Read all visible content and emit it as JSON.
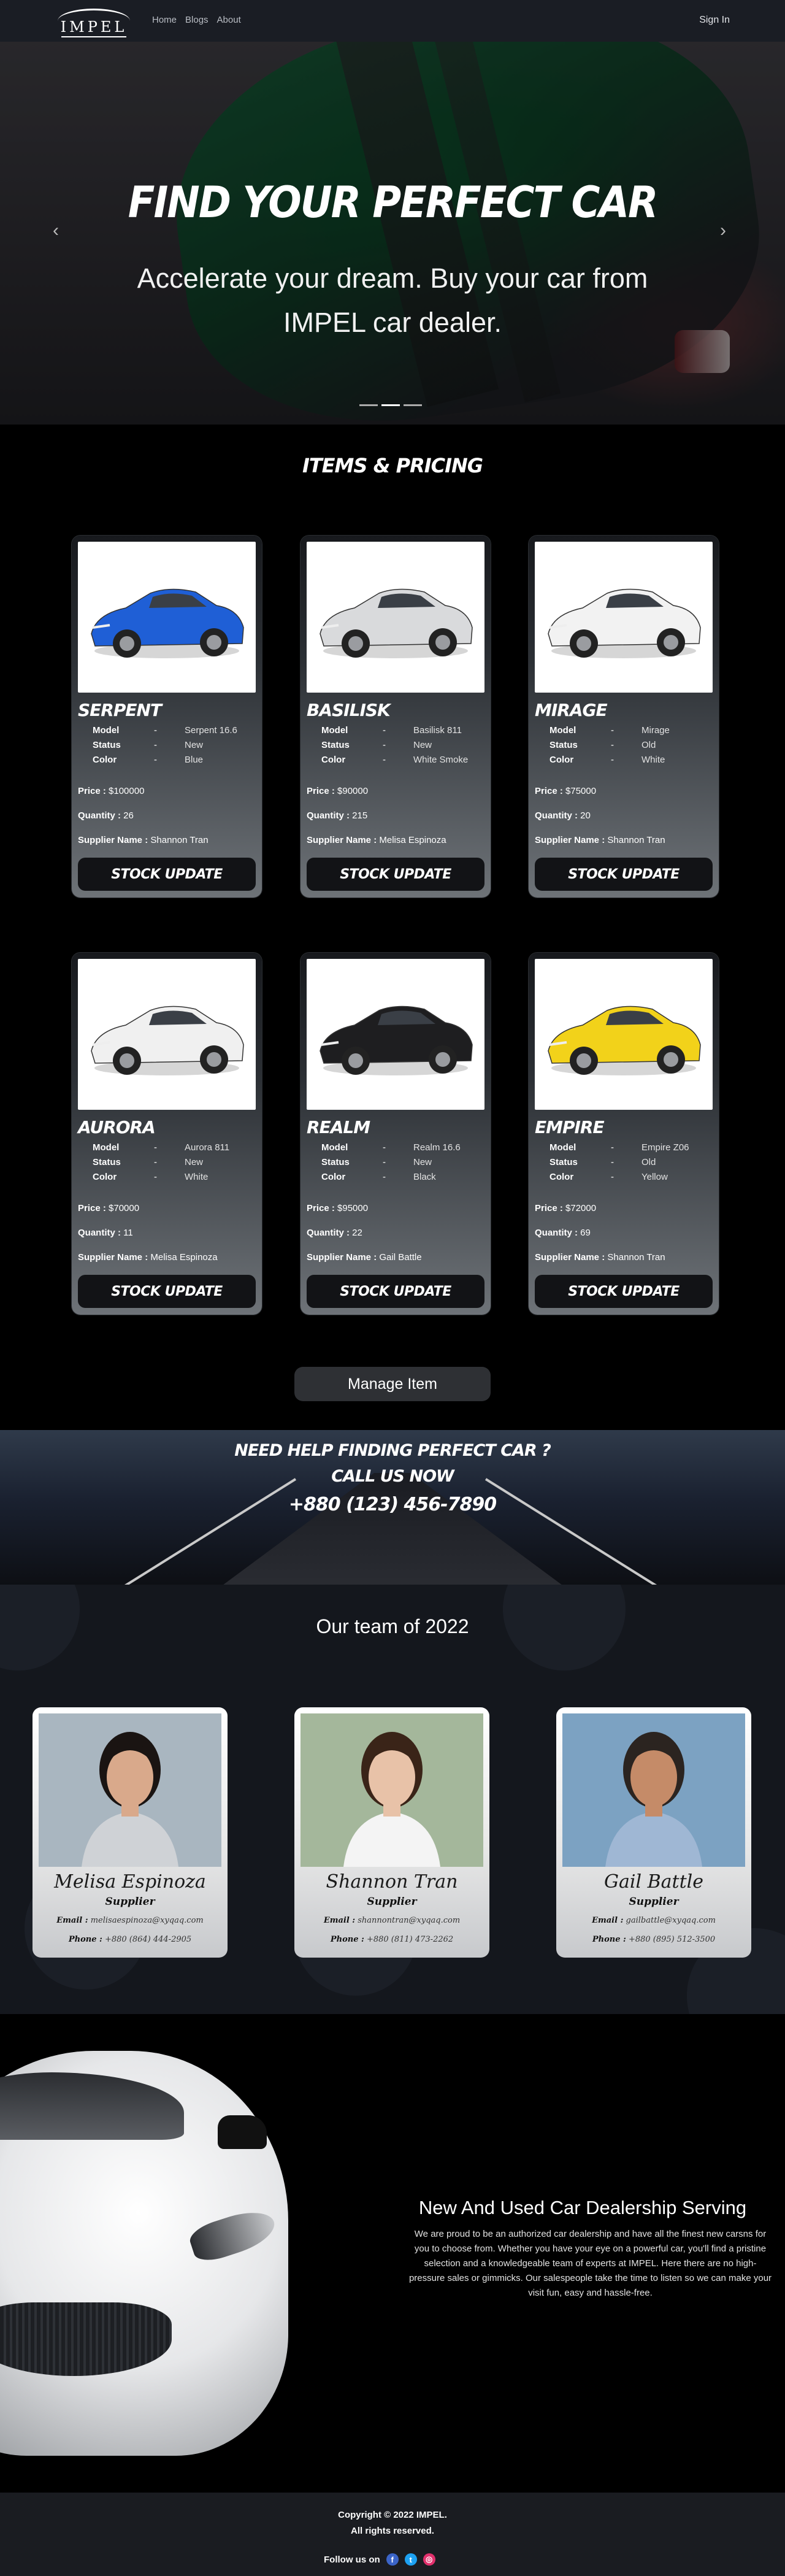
{
  "nav": {
    "logo_text": "IMPEL",
    "links": [
      "Home",
      "Blogs",
      "About"
    ],
    "signin": "Sign In"
  },
  "hero": {
    "title": "FIND YOUR PERFECT CAR",
    "subtitle": "Accelerate your dream. Buy your car from IMPEL car dealer.",
    "prev_icon": "chevron-left-icon",
    "next_icon": "chevron-right-icon",
    "slide_count": 3
  },
  "items": {
    "title": "ITEMS & PRICING",
    "labels": {
      "model": "Model",
      "status": "Status",
      "color": "Color",
      "price": "Price :",
      "quantity": "Quantity :",
      "supplier": "Supplier Name :",
      "button": "STOCK UPDATE"
    },
    "cards": [
      {
        "name": "SERPENT",
        "model": "Serpent 16.6",
        "status": "New",
        "color": "Blue",
        "price": "$100000",
        "quantity": "26",
        "supplier": "Shannon Tran",
        "car_color": "#1f5fd6"
      },
      {
        "name": "BASILISK",
        "model": "Basilisk 811",
        "status": "New",
        "color": "White Smoke",
        "price": "$90000",
        "quantity": "215",
        "supplier": "Melisa Espinoza",
        "car_color": "#d9dadc"
      },
      {
        "name": "MIRAGE",
        "model": "Mirage",
        "status": "Old",
        "color": "White",
        "price": "$75000",
        "quantity": "20",
        "supplier": "Shannon Tran",
        "car_color": "#f2f2f2"
      },
      {
        "name": "AURORA",
        "model": "Aurora 811",
        "status": "New",
        "color": "White",
        "price": "$70000",
        "quantity": "11",
        "supplier": "Melisa Espinoza",
        "car_color": "#f0f0f0"
      },
      {
        "name": "REALM",
        "model": "Realm 16.6",
        "status": "New",
        "color": "Black",
        "price": "$95000",
        "quantity": "22",
        "supplier": "Gail Battle",
        "car_color": "#1e1e20"
      },
      {
        "name": "EMPIRE",
        "model": "Empire Z06",
        "status": "Old",
        "color": "Yellow",
        "price": "$72000",
        "quantity": "69",
        "supplier": "Shannon Tran",
        "car_color": "#f2d21a"
      }
    ],
    "manage_button": "Manage Item"
  },
  "help": {
    "line1": "NEED HELP FINDING PERFECT CAR ?",
    "line2": "CALL US NOW",
    "phone": "+880 (123) 456-7890"
  },
  "team": {
    "title": "Our team of 2022",
    "members": [
      {
        "name": "Melisa Espinoza",
        "role": "Supplier",
        "email_label": "Email :",
        "email": "melisaespinoza@xyqaq.com",
        "phone_label": "Phone :",
        "phone": "+880 (864) 444-2905",
        "skin": "#d9a98b",
        "hair": "#1a1412",
        "shirt": "#cfd2d6",
        "bg": "#a9b6c0"
      },
      {
        "name": "Shannon Tran",
        "role": "Supplier",
        "email_label": "Email :",
        "email": "shannontran@xyqaq.com",
        "phone_label": "Phone :",
        "phone": "+880 (811) 473-2262",
        "skin": "#e8c2a8",
        "hair": "#3a2418",
        "shirt": "#f4f4f4",
        "bg": "#a4b79b"
      },
      {
        "name": "Gail Battle",
        "role": "Supplier",
        "email_label": "Email :",
        "email": "gailbattle@xyqaq.com",
        "phone_label": "Phone :",
        "phone": "+880 (895) 512-3500",
        "skin": "#c58b68",
        "hair": "#2b2420",
        "shirt": "#9fb7d4",
        "bg": "#7ca2c2"
      }
    ]
  },
  "dealer": {
    "title": "New And Used Car Dealership Serving",
    "text": "We are proud to be an authorized car dealership and have all the finest new carsns for you to choose from. Whether you have your eye on a powerful car, you'll find a pristine selection and a knowledgeable team of experts at IMPEL. Here there are no high-pressure sales or gimmicks. Our salespeople take the time to listen so we can make your visit fun, easy and hassle-free."
  },
  "footer": {
    "copyright": "Copyright © 2022 IMPEL.",
    "rights": "All rights reserved.",
    "follow": "Follow us on",
    "social": [
      {
        "icon": "facebook-icon",
        "glyph": "f",
        "color": "#3b64c8"
      },
      {
        "icon": "twitter-icon",
        "glyph": "t",
        "color": "#1da1f2"
      },
      {
        "icon": "instagram-icon",
        "glyph": "◎",
        "color": "#e1306c"
      }
    ]
  }
}
